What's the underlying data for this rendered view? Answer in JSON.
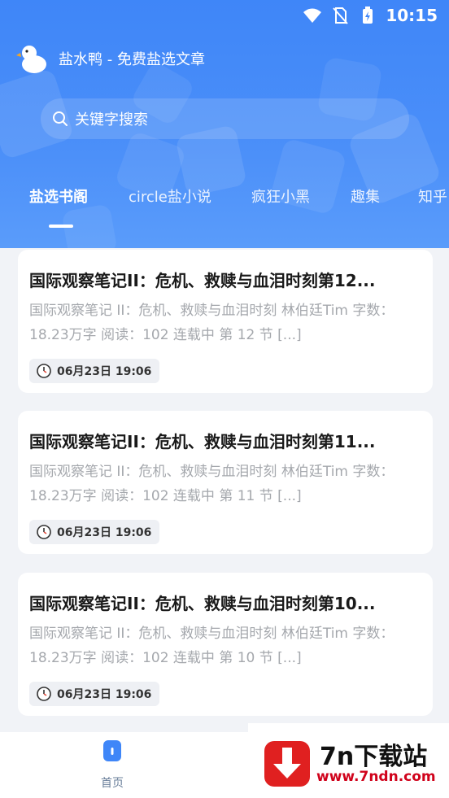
{
  "status_bar": {
    "time": "10:15",
    "icons": [
      "wifi-icon",
      "no-sim-icon",
      "battery-charging-icon"
    ]
  },
  "app": {
    "title": "盐水鸭 - 免费盐选文章",
    "logo_icon": "duck-icon"
  },
  "search": {
    "placeholder": "关键字搜索",
    "icon": "search-icon"
  },
  "tabs": [
    {
      "label": "盐选书阁",
      "active": true
    },
    {
      "label": "circle盐小说",
      "active": false
    },
    {
      "label": "疯狂小黑",
      "active": false
    },
    {
      "label": "趣集",
      "active": false
    },
    {
      "label": "知乎",
      "active": false
    }
  ],
  "articles": [
    {
      "title": "国际观察笔记II：危机、救赎与血泪时刻第12...",
      "summary": "国际观察笔记 II：危机、救赎与血泪时刻 林伯廷Tim 字数：18.23万字 阅读：102 连载中 第 12 节 [...]",
      "date": "06月23日 19:06"
    },
    {
      "title": "国际观察笔记II：危机、救赎与血泪时刻第11...",
      "summary": "国际观察笔记 II：危机、救赎与血泪时刻 林伯廷Tim 字数：18.23万字 阅读：102 连载中 第 11 节 [...]",
      "date": "06月23日 19:06"
    },
    {
      "title": "国际观察笔记II：危机、救赎与血泪时刻第10...",
      "summary": "国际观察笔记 II：危机、救赎与血泪时刻 林伯廷Tim 字数：18.23万字 阅读：102 连载中 第 10 节 [...]",
      "date": "06月23日 19:06"
    }
  ],
  "bottom_nav": {
    "home_label": "首页"
  },
  "watermark": {
    "title": "7n下载站",
    "url": "www.7ndn.com"
  },
  "colors": {
    "primary": "#3f86f8",
    "summary_text": "#a5a8ad",
    "watermark_red": "#d0021b"
  }
}
